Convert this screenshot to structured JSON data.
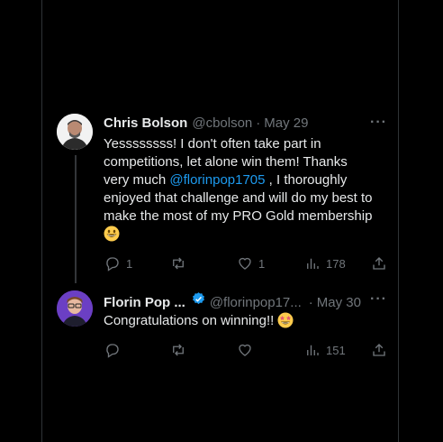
{
  "tweets": [
    {
      "display_name": "Chris Bolson",
      "handle": "@cbolson",
      "separator": "·",
      "date": "May 29",
      "text_lines": [
        "Yessssssss!  I don't often take part in",
        "competitions, let alone win them!  Thanks"
      ],
      "text_pre_mention": "very much ",
      "mention": "@florinpop1705",
      "text_post_mention": " , I thoroughly",
      "text_line5": "enjoyed that challenge and will do my best to",
      "text_line6": "make the most of my PRO Gold membership",
      "emoji": "grinning-face",
      "reply_count": "1",
      "like_count": "1",
      "view_count": "178"
    },
    {
      "display_name": "Florin Pop ...",
      "handle": "@florinpop17...",
      "separator": "·",
      "date": "May 30",
      "text": "Congratulations on winning!! ",
      "emoji": "star-struck",
      "view_count": "151",
      "verified_color": "#1d9bf0"
    }
  ]
}
